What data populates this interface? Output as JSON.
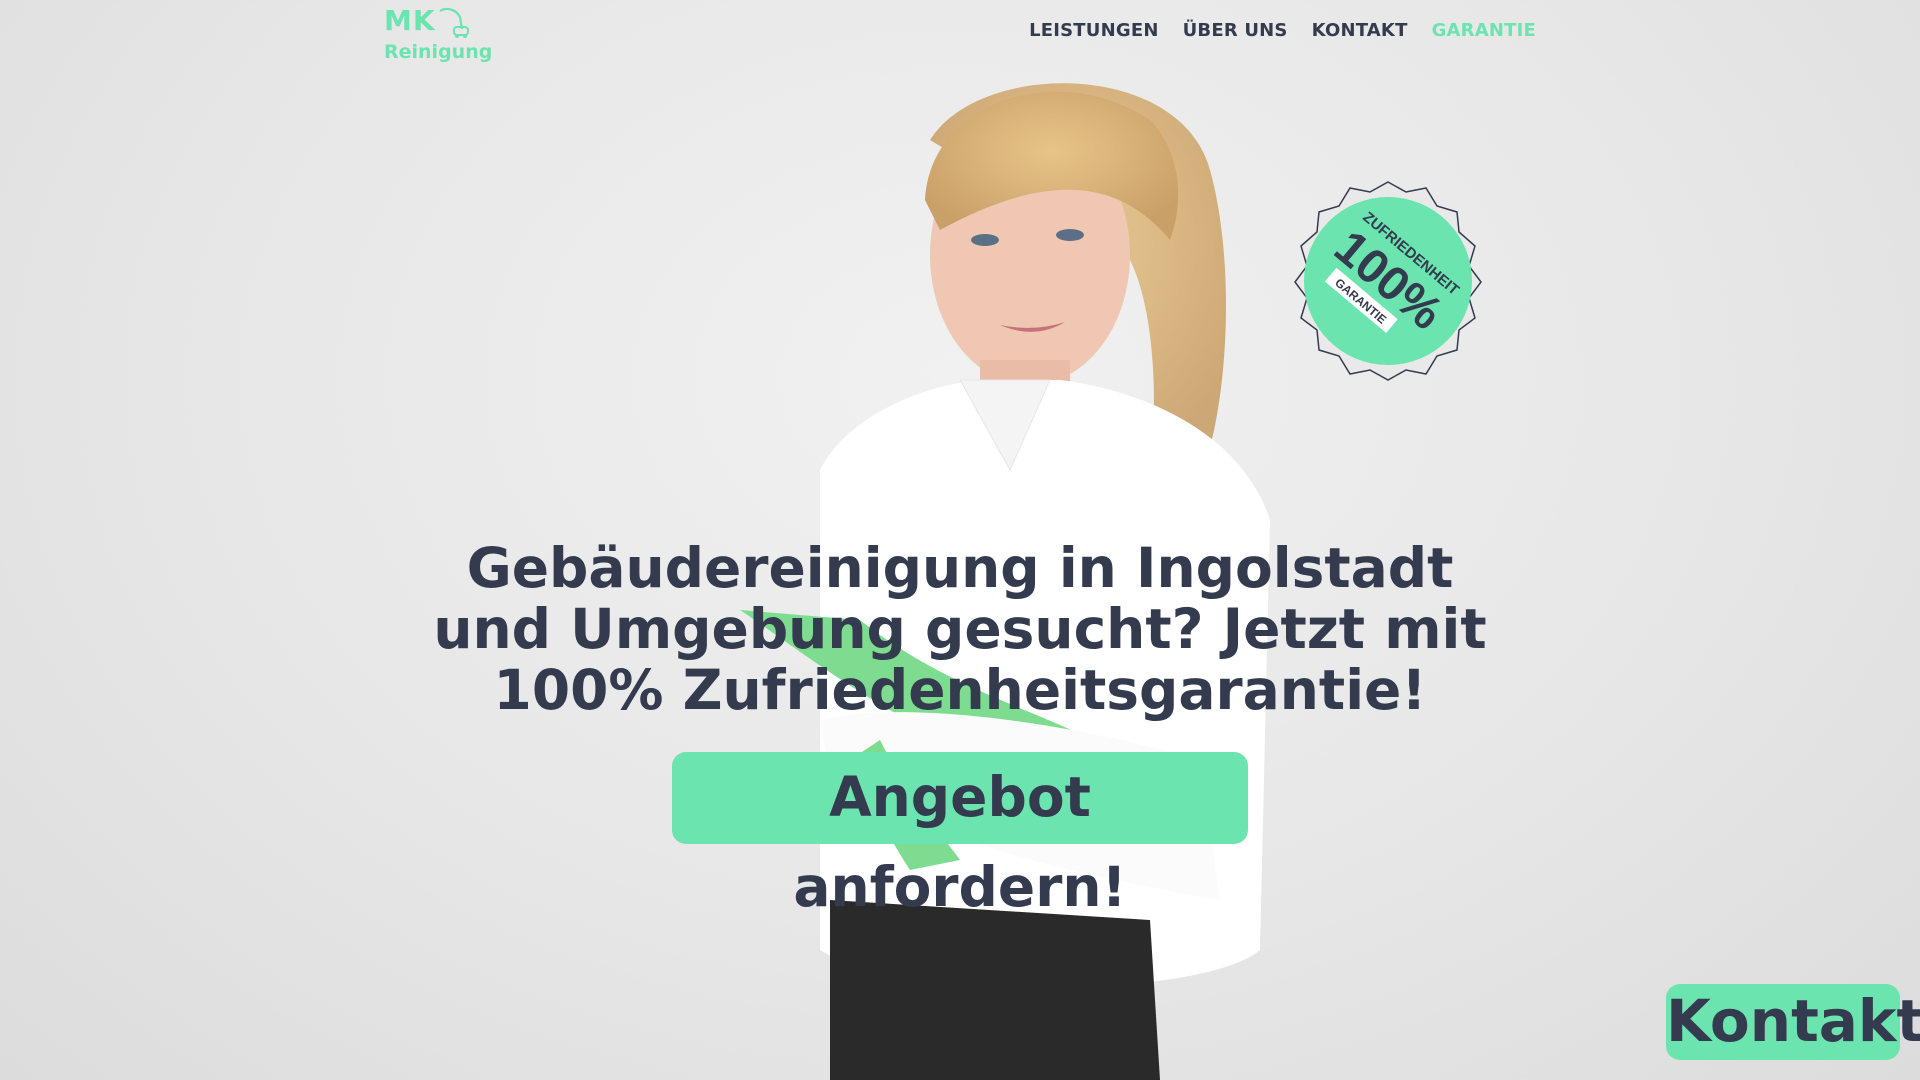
{
  "brand": {
    "name": "MK",
    "subtitle": "Reinigung",
    "logo_icon": "vacuum-cleaner-icon",
    "color": "#6be4b0"
  },
  "nav": {
    "items": [
      {
        "label": "LEISTUNGEN",
        "active": false
      },
      {
        "label": "ÜBER UNS",
        "active": false
      },
      {
        "label": "KONTAKT",
        "active": false
      },
      {
        "label": "GARANTIE",
        "active": true
      }
    ]
  },
  "badge": {
    "line1": "ZUFRIEDENHEIT",
    "line2": "100%",
    "line3": "GARANTIE"
  },
  "hero": {
    "headline": "Gebäudereinigung in Ingolstadt und Umgebung gesucht? Jetzt mit 100% Zufriedenheitsgarantie!",
    "cta_label": "Angebot anfordern!"
  },
  "floating_button": {
    "label": "Kontakt"
  },
  "colors": {
    "accent": "#6be4b0",
    "text": "#343b4e",
    "background": "#e8e8e8"
  }
}
